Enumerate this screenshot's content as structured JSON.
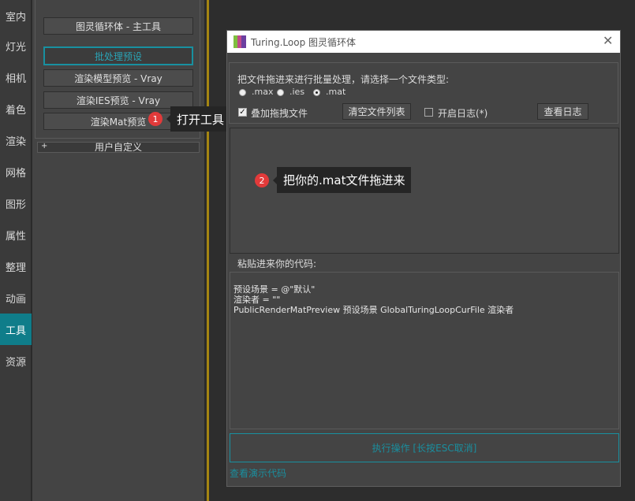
{
  "sidebar": {
    "items": [
      {
        "label": "室内"
      },
      {
        "label": "灯光"
      },
      {
        "label": "相机"
      },
      {
        "label": "着色"
      },
      {
        "label": "渲染"
      },
      {
        "label": "网格"
      },
      {
        "label": "图形"
      },
      {
        "label": "属性"
      },
      {
        "label": "整理"
      },
      {
        "label": "动画"
      },
      {
        "label": "工具"
      },
      {
        "label": "资源"
      }
    ],
    "active_index": 10
  },
  "panel": {
    "buttons": [
      {
        "label": "图灵循环体 - 主工具"
      },
      {
        "label": "批处理预设"
      },
      {
        "label": "渲染模型预览 - Vray"
      },
      {
        "label": "渲染IES预览 - Vray"
      },
      {
        "label": "渲染Mat预览"
      }
    ],
    "rollout_toggle": "+",
    "rollout_label": "用户自定义"
  },
  "callouts": [
    {
      "number": "1",
      "text": "打开工具"
    },
    {
      "number": "2",
      "text": "把你的.mat文件拖进来"
    }
  ],
  "dialog": {
    "title": "Turing.Loop 图灵循环体",
    "close_symbol": "✕",
    "instruction": "把文件拖进来进行批量处理，请选择一个文件类型:",
    "file_types": [
      ".max",
      ".ies",
      ".mat"
    ],
    "selected_type": ".mat",
    "append_drag_label": "叠加拖拽文件",
    "append_drag_checked": true,
    "clear_list_button": "清空文件列表",
    "enable_log_label": "开启日志(*)",
    "enable_log_checked": false,
    "view_log_button": "查看日志",
    "paste_code_label": "粘贴进来你的代码:",
    "code_lines": [
      "预设场景 = @\"默认\"",
      "渲染者 = \"\"",
      "PublicRenderMatPreview 预设场景 GlobalTuringLoopCurFile 渲染者"
    ],
    "execute_button": "执行操作 [长按ESC取消]",
    "demo_link": "查看演示代码"
  },
  "colors": {
    "accent": "#1890a0",
    "badge": "#e23a3a",
    "divider": "#a48512"
  }
}
